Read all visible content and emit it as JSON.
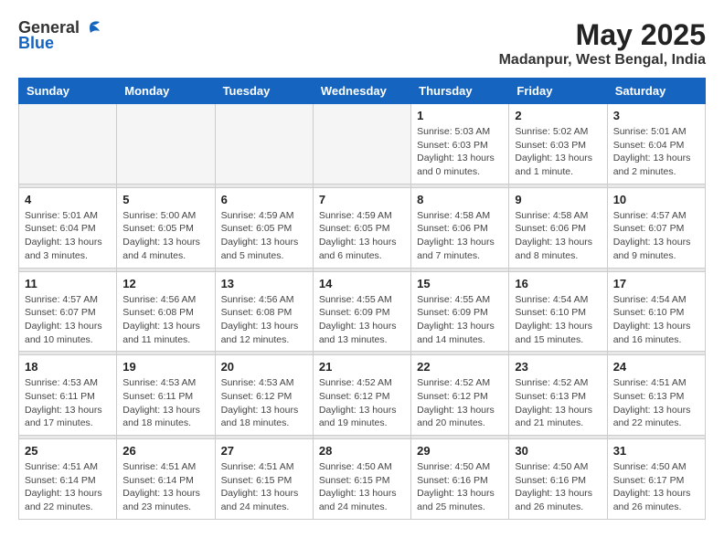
{
  "header": {
    "logo_general": "General",
    "logo_blue": "Blue",
    "title": "May 2025",
    "subtitle": "Madanpur, West Bengal, India"
  },
  "calendar": {
    "days_of_week": [
      "Sunday",
      "Monday",
      "Tuesday",
      "Wednesday",
      "Thursday",
      "Friday",
      "Saturday"
    ],
    "weeks": [
      {
        "days": [
          {
            "number": "",
            "info": "",
            "empty": true
          },
          {
            "number": "",
            "info": "",
            "empty": true
          },
          {
            "number": "",
            "info": "",
            "empty": true
          },
          {
            "number": "",
            "info": "",
            "empty": true
          },
          {
            "number": "1",
            "info": "Sunrise: 5:03 AM\nSunset: 6:03 PM\nDaylight: 13 hours\nand 0 minutes."
          },
          {
            "number": "2",
            "info": "Sunrise: 5:02 AM\nSunset: 6:03 PM\nDaylight: 13 hours\nand 1 minute."
          },
          {
            "number": "3",
            "info": "Sunrise: 5:01 AM\nSunset: 6:04 PM\nDaylight: 13 hours\nand 2 minutes."
          }
        ]
      },
      {
        "days": [
          {
            "number": "4",
            "info": "Sunrise: 5:01 AM\nSunset: 6:04 PM\nDaylight: 13 hours\nand 3 minutes."
          },
          {
            "number": "5",
            "info": "Sunrise: 5:00 AM\nSunset: 6:05 PM\nDaylight: 13 hours\nand 4 minutes."
          },
          {
            "number": "6",
            "info": "Sunrise: 4:59 AM\nSunset: 6:05 PM\nDaylight: 13 hours\nand 5 minutes."
          },
          {
            "number": "7",
            "info": "Sunrise: 4:59 AM\nSunset: 6:05 PM\nDaylight: 13 hours\nand 6 minutes."
          },
          {
            "number": "8",
            "info": "Sunrise: 4:58 AM\nSunset: 6:06 PM\nDaylight: 13 hours\nand 7 minutes."
          },
          {
            "number": "9",
            "info": "Sunrise: 4:58 AM\nSunset: 6:06 PM\nDaylight: 13 hours\nand 8 minutes."
          },
          {
            "number": "10",
            "info": "Sunrise: 4:57 AM\nSunset: 6:07 PM\nDaylight: 13 hours\nand 9 minutes."
          }
        ]
      },
      {
        "days": [
          {
            "number": "11",
            "info": "Sunrise: 4:57 AM\nSunset: 6:07 PM\nDaylight: 13 hours\nand 10 minutes."
          },
          {
            "number": "12",
            "info": "Sunrise: 4:56 AM\nSunset: 6:08 PM\nDaylight: 13 hours\nand 11 minutes."
          },
          {
            "number": "13",
            "info": "Sunrise: 4:56 AM\nSunset: 6:08 PM\nDaylight: 13 hours\nand 12 minutes."
          },
          {
            "number": "14",
            "info": "Sunrise: 4:55 AM\nSunset: 6:09 PM\nDaylight: 13 hours\nand 13 minutes."
          },
          {
            "number": "15",
            "info": "Sunrise: 4:55 AM\nSunset: 6:09 PM\nDaylight: 13 hours\nand 14 minutes."
          },
          {
            "number": "16",
            "info": "Sunrise: 4:54 AM\nSunset: 6:10 PM\nDaylight: 13 hours\nand 15 minutes."
          },
          {
            "number": "17",
            "info": "Sunrise: 4:54 AM\nSunset: 6:10 PM\nDaylight: 13 hours\nand 16 minutes."
          }
        ]
      },
      {
        "days": [
          {
            "number": "18",
            "info": "Sunrise: 4:53 AM\nSunset: 6:11 PM\nDaylight: 13 hours\nand 17 minutes."
          },
          {
            "number": "19",
            "info": "Sunrise: 4:53 AM\nSunset: 6:11 PM\nDaylight: 13 hours\nand 18 minutes."
          },
          {
            "number": "20",
            "info": "Sunrise: 4:53 AM\nSunset: 6:12 PM\nDaylight: 13 hours\nand 18 minutes."
          },
          {
            "number": "21",
            "info": "Sunrise: 4:52 AM\nSunset: 6:12 PM\nDaylight: 13 hours\nand 19 minutes."
          },
          {
            "number": "22",
            "info": "Sunrise: 4:52 AM\nSunset: 6:12 PM\nDaylight: 13 hours\nand 20 minutes."
          },
          {
            "number": "23",
            "info": "Sunrise: 4:52 AM\nSunset: 6:13 PM\nDaylight: 13 hours\nand 21 minutes."
          },
          {
            "number": "24",
            "info": "Sunrise: 4:51 AM\nSunset: 6:13 PM\nDaylight: 13 hours\nand 22 minutes."
          }
        ]
      },
      {
        "days": [
          {
            "number": "25",
            "info": "Sunrise: 4:51 AM\nSunset: 6:14 PM\nDaylight: 13 hours\nand 22 minutes."
          },
          {
            "number": "26",
            "info": "Sunrise: 4:51 AM\nSunset: 6:14 PM\nDaylight: 13 hours\nand 23 minutes."
          },
          {
            "number": "27",
            "info": "Sunrise: 4:51 AM\nSunset: 6:15 PM\nDaylight: 13 hours\nand 24 minutes."
          },
          {
            "number": "28",
            "info": "Sunrise: 4:50 AM\nSunset: 6:15 PM\nDaylight: 13 hours\nand 24 minutes."
          },
          {
            "number": "29",
            "info": "Sunrise: 4:50 AM\nSunset: 6:16 PM\nDaylight: 13 hours\nand 25 minutes."
          },
          {
            "number": "30",
            "info": "Sunrise: 4:50 AM\nSunset: 6:16 PM\nDaylight: 13 hours\nand 26 minutes."
          },
          {
            "number": "31",
            "info": "Sunrise: 4:50 AM\nSunset: 6:17 PM\nDaylight: 13 hours\nand 26 minutes."
          }
        ]
      }
    ]
  }
}
